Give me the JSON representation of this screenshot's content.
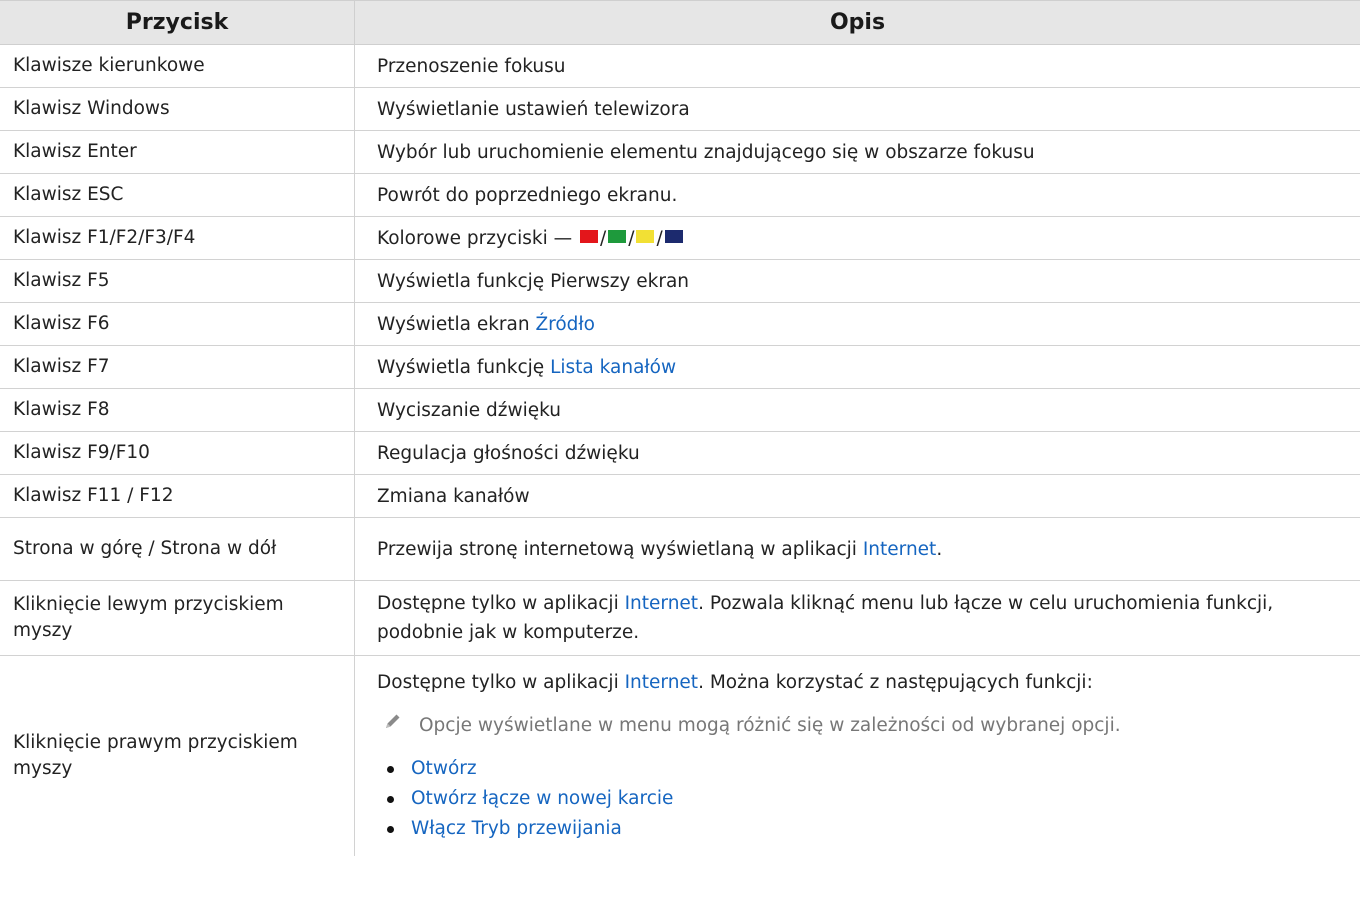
{
  "header": {
    "col1": "Przycisk",
    "col2": "Opis"
  },
  "rows": [
    {
      "button": "Klawisze kierunkowe",
      "desc": "Przenoszenie fokusu"
    },
    {
      "button": "Klawisz Windows",
      "desc": "Wyświetlanie ustawień telewizora"
    },
    {
      "button": "Klawisz Enter",
      "desc": "Wybór lub uruchomienie elementu znajdującego się w obszarze fokusu"
    },
    {
      "button": "Klawisz ESC",
      "desc": "Powrót do poprzedniego ekranu."
    },
    {
      "button": "Klawisz F1/F2/F3/F4",
      "desc_prefix": "Kolorowe przyciski —",
      "sep": "/",
      "colors": [
        "#e3161b",
        "#1e9a3c",
        "#f2e034",
        "#1c2a6e"
      ]
    },
    {
      "button": "Klawisz F5",
      "desc": "Wyświetla funkcję Pierwszy ekran"
    },
    {
      "button": "Klawisz F6",
      "desc_prefix": "Wyświetla ekran ",
      "desc_link": "Źródło"
    },
    {
      "button": "Klawisz F7",
      "desc_prefix": "Wyświetla funkcję ",
      "desc_link": "Lista kanałów"
    },
    {
      "button": "Klawisz F8",
      "desc": "Wyciszanie dźwięku"
    },
    {
      "button": "Klawisz F9/F10",
      "desc": "Regulacja głośności dźwięku"
    },
    {
      "button": "Klawisz F11 / F12",
      "desc": "Zmiana kanałów"
    },
    {
      "button": "Strona w górę / Strona w dół",
      "desc_prefix": "Przewija stronę internetową wyświetlaną w aplikacji ",
      "desc_link": "Internet",
      "desc_suffix": "."
    },
    {
      "button": "Kliknięcie lewym przyciskiem myszy",
      "desc_prefix": "Dostępne tylko w aplikacji ",
      "desc_link": "Internet",
      "desc_suffix": ". Pozwala kliknąć menu lub łącze w celu uruchomienia funkcji, podobnie jak w komputerze."
    },
    {
      "button": "Kliknięcie prawym przyciskiem myszy",
      "desc_prefix": "Dostępne tylko w aplikacji ",
      "desc_link": "Internet",
      "desc_suffix": ". Można korzystać z następujących funkcji:",
      "note": "Opcje wyświetlane w menu mogą różnić się w zależności od wybranej opcji.",
      "bullets": [
        "Otwórz",
        "Otwórz łącze w nowej karcie",
        "Włącz Tryb przewijania"
      ]
    }
  ],
  "colors": {
    "link": "#1565c0",
    "header_bg": "#e6e6e6",
    "note": "#777777"
  }
}
